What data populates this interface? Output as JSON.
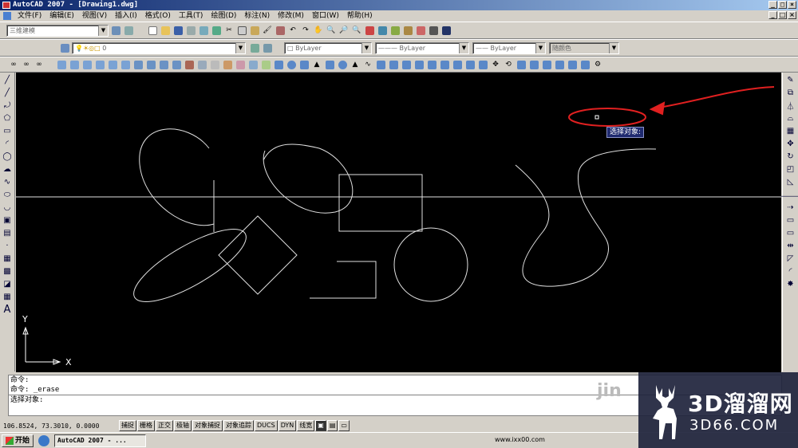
{
  "titlebar": {
    "title": "AutoCAD 2007 - [Drawing1.dwg]"
  },
  "window_buttons": [
    "_",
    "□",
    "×"
  ],
  "menu": {
    "items": [
      "文件(F)",
      "编辑(E)",
      "视图(V)",
      "插入(I)",
      "格式(O)",
      "工具(T)",
      "绘图(D)",
      "标注(N)",
      "修改(M)",
      "窗口(W)",
      "帮助(H)"
    ]
  },
  "toolbar": {
    "workspace": "三维建模",
    "layer": "0",
    "color": "ByLayer",
    "linetype": "ByLayer",
    "lineweight": "ByLayer",
    "plotstyle": "随颜色"
  },
  "canvas": {
    "tooltip": "选择对象:",
    "ucs_x": "X",
    "ucs_y": "Y"
  },
  "command": {
    "lines": [
      "命令:",
      "命令: _erase"
    ],
    "prompt": "选择对象:"
  },
  "status": {
    "coords": "106.8524, 73.3010, 0.0000",
    "buttons": [
      "捕捉",
      "栅格",
      "正交",
      "极轴",
      "对象捕捉",
      "对象追踪",
      "DUCS",
      "DYN",
      "线宽"
    ]
  },
  "taskbar": {
    "start": "开始",
    "task": "AutoCAD 2007 - ...",
    "tray_text": "www.ixx00.com"
  },
  "watermark": {
    "big": "3D溜溜网",
    "small": "3D66.COM",
    "partial": "jin"
  },
  "colors": {
    "canvas": "#000000",
    "annotation": "#e02020",
    "title_start": "#0a246a"
  }
}
